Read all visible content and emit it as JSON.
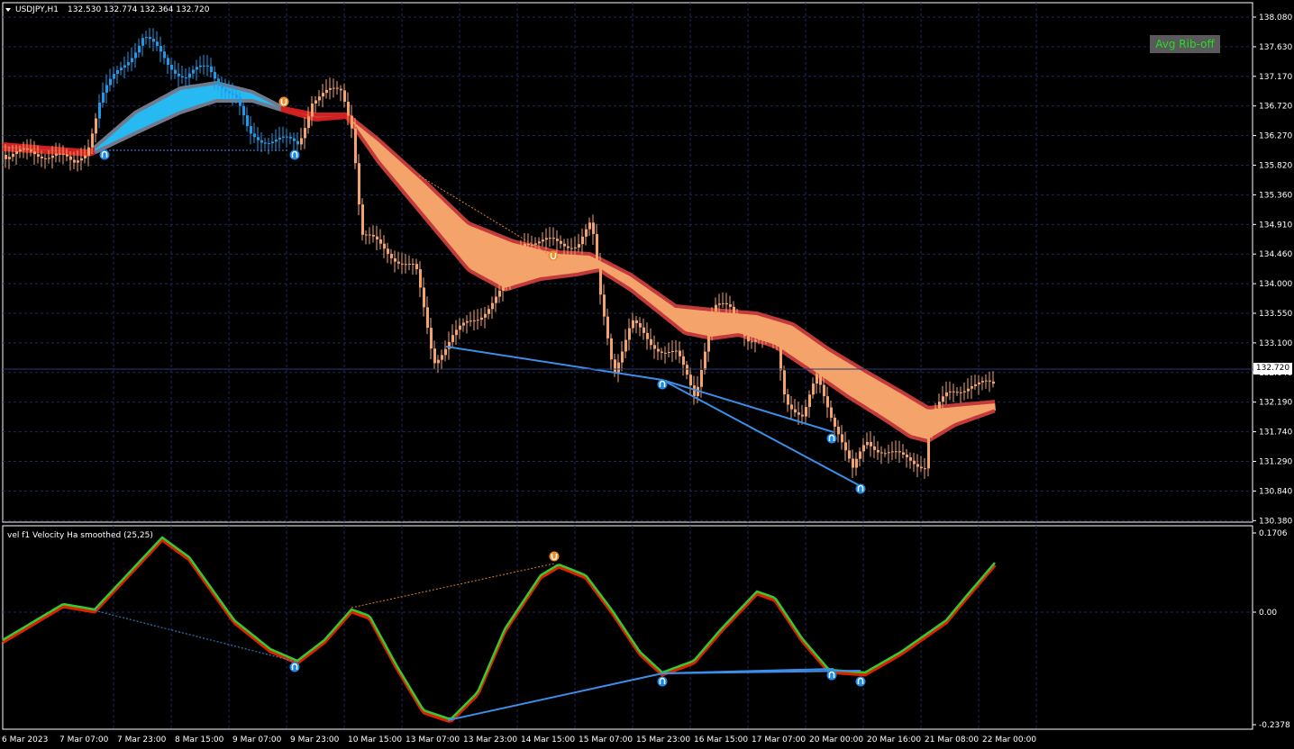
{
  "header": {
    "symbol": "USDJPY,H1",
    "ohlc": "132.530 132.774 132.364 132.720"
  },
  "button": {
    "label": "Avg Rib-off"
  },
  "current_price": "132.720",
  "price_axis": [
    "138.080",
    "137.630",
    "137.170",
    "136.720",
    "136.270",
    "135.820",
    "135.360",
    "134.910",
    "134.460",
    "134.000",
    "133.550",
    "133.100",
    "132.640",
    "132.190",
    "131.740",
    "131.290",
    "130.840",
    "130.380"
  ],
  "indicator": {
    "title": "vel f1 Velocity Ha smoothed (25,25)",
    "axis": [
      "0.1706",
      "0.00",
      "-0.2378"
    ]
  },
  "time_axis": [
    "6 Mar 2023",
    "7 Mar 07:00",
    "7 Mar 23:00",
    "8 Mar 15:00",
    "9 Mar 07:00",
    "9 Mar 23:00",
    "10 Mar 15:00",
    "13 Mar 07:00",
    "13 Mar 23:00",
    "14 Mar 15:00",
    "15 Mar 07:00",
    "15 Mar 23:00",
    "16 Mar 15:00",
    "17 Mar 07:00",
    "20 Mar 00:00",
    "20 Mar 16:00",
    "21 Mar 08:00",
    "22 Mar 00:00"
  ],
  "colors": {
    "background": "#000000",
    "grid": "#1c2a5a",
    "candle_blue": "#1e9be8",
    "candle_orange": "#f4a46a",
    "ribbon_up": "#27b9f2",
    "ribbon_down": "#f4a46a",
    "ribbon_edge_red": "#d02020",
    "ribbon_edge_grey": "#707a8c",
    "divergence_line": "#3b8fe8",
    "vel_green": "#33cc33",
    "vel_red": "#dd2200"
  },
  "icons": [
    "divergence-up-arrow-icon",
    "divergence-down-arrow-icon",
    "dropdown-triangle-icon"
  ]
}
